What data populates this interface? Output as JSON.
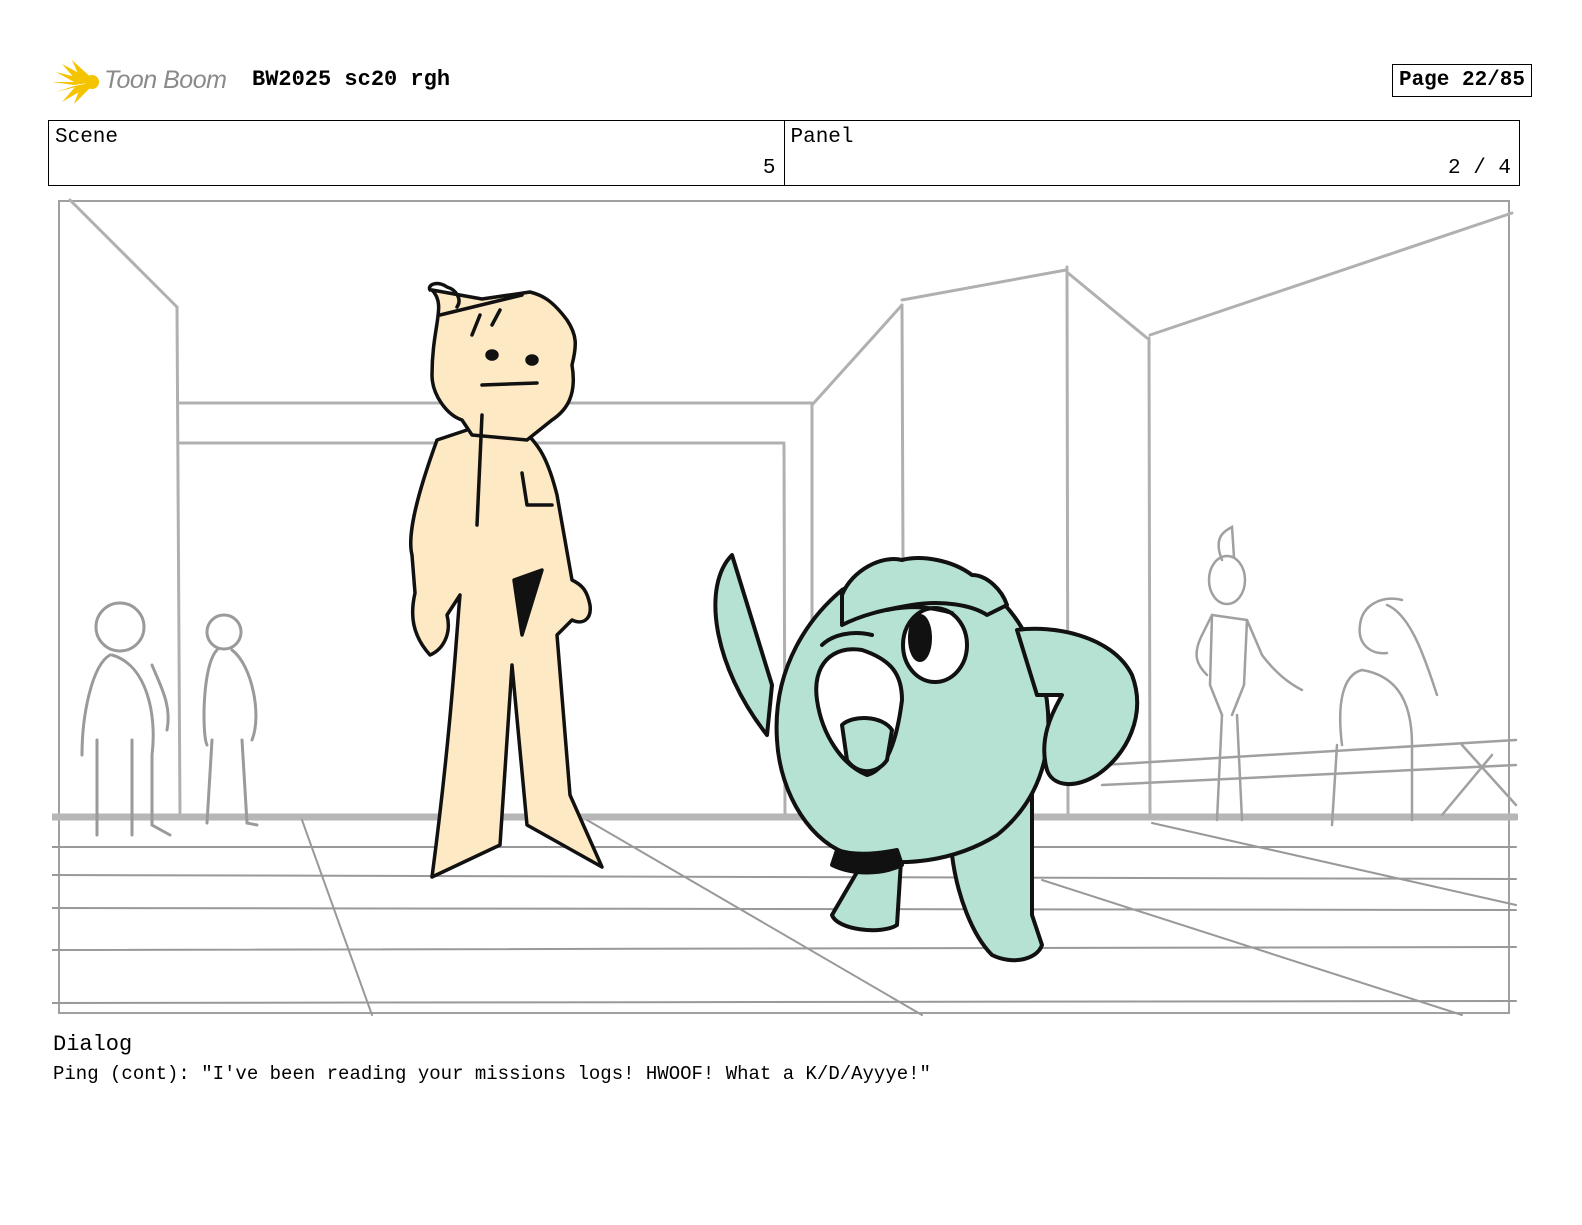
{
  "header": {
    "brand_text": "Toon Boom",
    "title": "BW2025 sc20 rgh",
    "page_label": "Page 22/85"
  },
  "info": {
    "scene_label": "Scene",
    "scene_value": "5",
    "panel_label": "Panel",
    "panel_value": "2 / 4"
  },
  "panel_image": {
    "description_icon": "storyboard-sketch",
    "colors": {
      "girl_fill": "#fde9c3",
      "creature_fill": "#b6e2d3",
      "background_lines": "#a8a8a8"
    }
  },
  "dialog": {
    "label": "Dialog",
    "text": "Ping (cont): \"I've been reading your missions logs! HWOOF! What a K/D/Ayyye!\""
  }
}
